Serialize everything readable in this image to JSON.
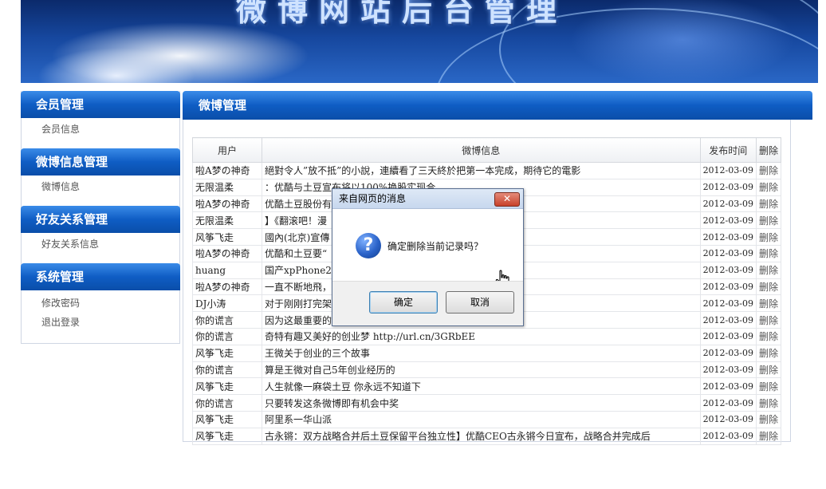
{
  "banner": {
    "title": "微博网站后台管理"
  },
  "sidebar": {
    "groups": [
      {
        "title": "会员管理",
        "items": [
          "会员信息"
        ]
      },
      {
        "title": "微博信息管理",
        "items": [
          "微博信息"
        ]
      },
      {
        "title": "好友关系管理",
        "items": [
          "好友关系信息"
        ]
      },
      {
        "title": "系统管理",
        "items": [
          "修改密码",
          "退出登录"
        ]
      }
    ]
  },
  "main": {
    "title": "微博管理",
    "columns": [
      "用户",
      "微博信息",
      "发布时间",
      "删除"
    ],
    "rows": [
      [
        "啦A梦の神奇",
        "絕對令人”放不抵”的小說，連續看了三天終於把第一本完成，期待它的電影",
        "2012-03-09",
        "删除"
      ],
      [
        "无限温柔",
        "：优酷与土豆宣布将以100%换股实现合",
        "2012-03-09",
        "删除"
      ],
      [
        "啦A梦の神奇",
        "优酷土豆股份有限",
        "2012-03-09",
        "删除"
      ],
      [
        "无限温柔",
        "】《翻滚吧！漫",
        "2012-03-09",
        "删除"
      ],
      [
        "风筝飞走",
        "國內(北京)宣傳",
        "2012-03-09",
        "删除"
      ],
      [
        "啦A梦の神奇",
        "优酷和土豆要“",
        "2012-03-09",
        "删除"
      ],
      [
        "huang",
        "国产xpPhone2智",
        "2012-03-09",
        "删除"
      ],
      [
        "啦A梦の神奇",
        "一直不断地飛，",
        "2012-03-09",
        "删除"
      ],
      [
        "DJ小涛",
        "对于刚刚打完架",
        "2012-03-09",
        "删除"
      ],
      [
        "你的谎言",
        "因为这最重要的",
        "2012-03-09",
        "删除"
      ],
      [
        "你的谎言",
        "奇特有趣又美好的创业梦 http://url.cn/3GRbEE",
        "2012-03-09",
        "删除"
      ],
      [
        "风筝飞走",
        "王微关于创业的三个故事",
        "2012-03-09",
        "删除"
      ],
      [
        "你的谎言",
        "算是王微对自己5年创业经历的",
        "2012-03-09",
        "删除"
      ],
      [
        "风筝飞走",
        "人生就像一麻袋土豆 你永远不知道下",
        "2012-03-09",
        "删除"
      ],
      [
        "你的谎言",
        "只要转发这条微博即有机会中奖",
        "2012-03-09",
        "删除"
      ],
      [
        "风筝飞走",
        "阿里系一华山派",
        "2012-03-09",
        "删除"
      ],
      [
        "风筝飞走",
        "古永锵：双方战略合并后土豆保留平台独立性】优酷CEO古永锵今日宣布，战略合并完成后",
        "2012-03-09",
        "删除"
      ]
    ]
  },
  "dialog": {
    "title": "来自网页的消息",
    "close_label": "✕",
    "icon": "question-icon",
    "message": "确定删除当前记录吗？",
    "ok_label": "确定",
    "cancel_label": "取消"
  }
}
